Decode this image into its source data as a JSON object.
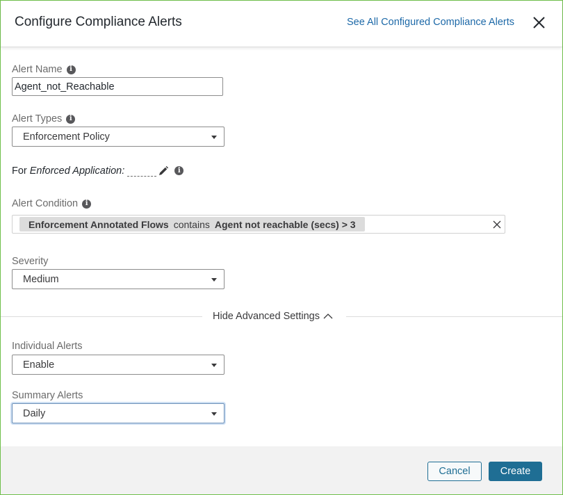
{
  "header": {
    "title": "Configure Compliance Alerts",
    "link_label": "See All Configured Compliance Alerts",
    "close_icon": "close-icon"
  },
  "form": {
    "alert_name": {
      "label": "Alert Name",
      "value": "Agent_not_Reachable"
    },
    "alert_types": {
      "label": "Alert Types",
      "selected": "Enforcement Policy"
    },
    "for_application": {
      "prefix": "For",
      "label": "Enforced Application:",
      "value": ""
    },
    "alert_condition": {
      "label": "Alert Condition",
      "field": "Enforcement Annotated Flows",
      "operator": "contains",
      "value": "Agent not reachable (secs) > 3"
    },
    "severity": {
      "label": "Severity",
      "selected": "Medium"
    },
    "advanced_toggle": "Hide Advanced Settings",
    "individual_alerts": {
      "label": "Individual Alerts",
      "selected": "Enable"
    },
    "summary_alerts": {
      "label": "Summary Alerts",
      "selected": "Daily"
    }
  },
  "footer": {
    "cancel_label": "Cancel",
    "create_label": "Create"
  },
  "colors": {
    "accent": "#1f6e94",
    "link": "#1d69a8",
    "dialog_border": "#6fbf4a"
  }
}
